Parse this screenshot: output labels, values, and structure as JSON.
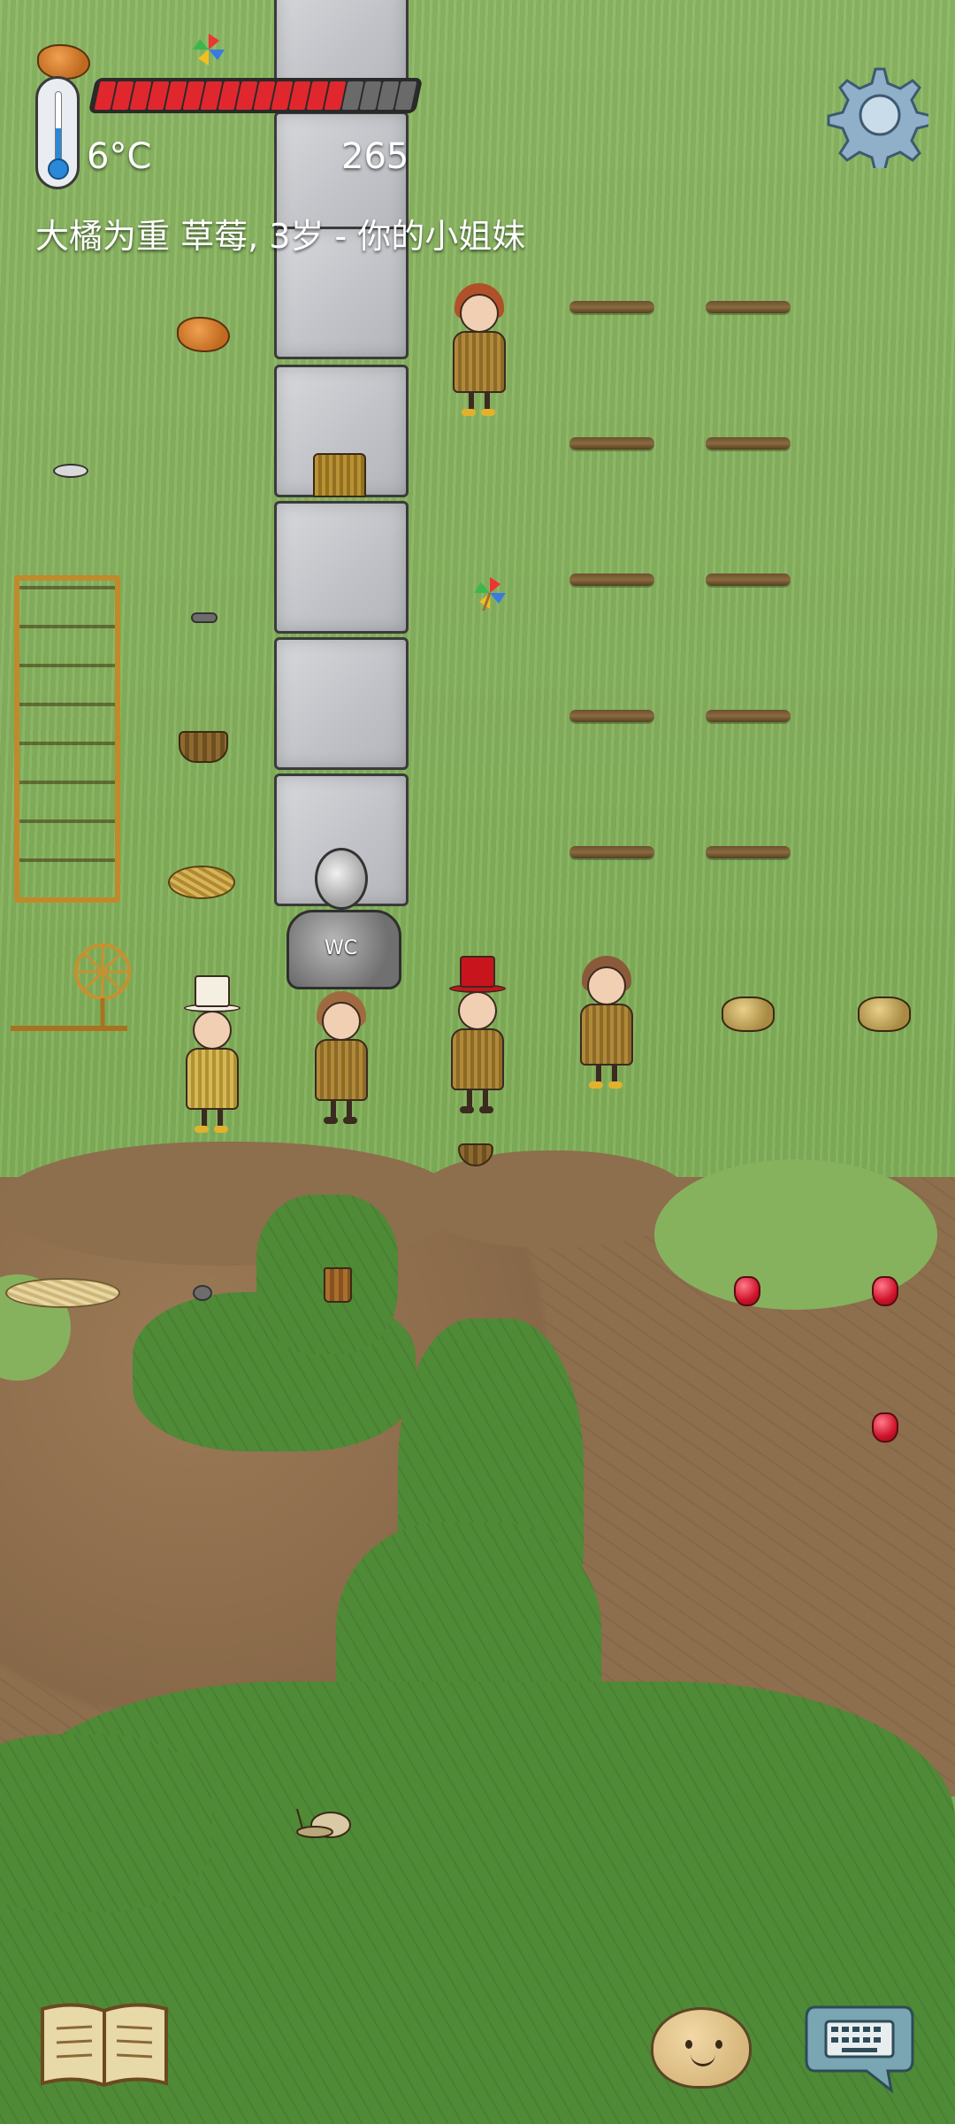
{
  "hud": {
    "temperature": "6°C",
    "counter": "265",
    "player_info": "大橘为重 草莓, 3岁 - 你的小姐妹",
    "food_pips": {
      "filled": 14,
      "total": 18
    },
    "colors": {
      "food_filled": "#e0272d",
      "food_empty": "#6a6a6a",
      "thermo_fill": "#2a88d8"
    }
  },
  "world": {
    "well_label": "WC"
  },
  "controls": {
    "settings_icon": "gear-icon",
    "book_icon": "book-icon",
    "emote_icon": "face-emote-icon",
    "keyboard_icon": "keyboard-chat-icon"
  }
}
